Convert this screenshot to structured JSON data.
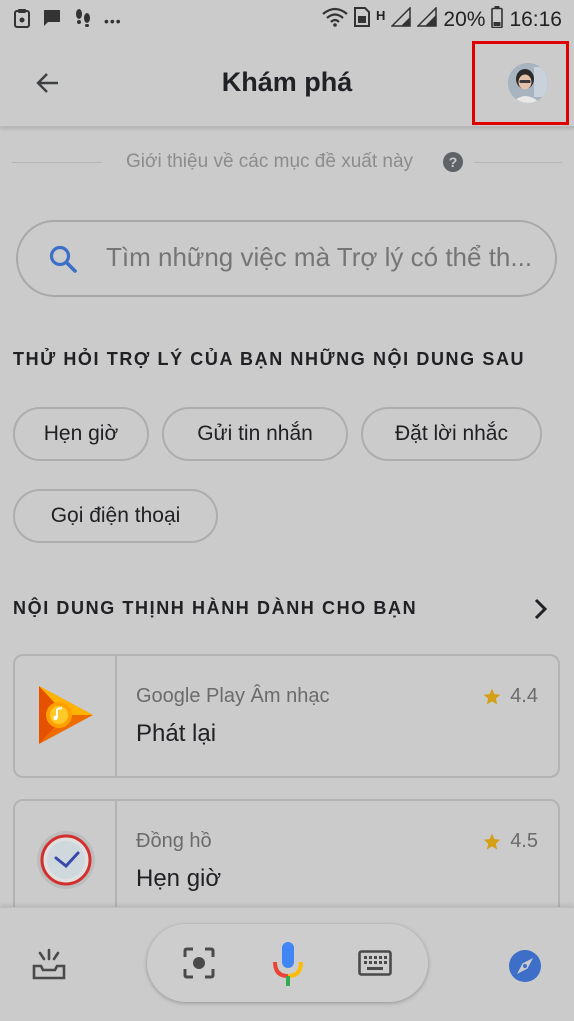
{
  "status_bar": {
    "battery_percent": "20%",
    "time": "16:16",
    "network_label": "H",
    "overflow_dots": "•••"
  },
  "app_bar": {
    "title": "Khám phá"
  },
  "intro": {
    "text": "Giới thiệu về các mục đề xuất này",
    "help_glyph": "?"
  },
  "search": {
    "placeholder": "Tìm những việc mà Trợ lý có thể th..."
  },
  "try_section": {
    "header": "THỬ HỎI TRỢ LÝ CỦA BẠN NHỮNG NỘI DUNG SAU",
    "chips": [
      "Hẹn giờ",
      "Gửi tin nhắn",
      "Đặt lời nhắc",
      "Gọi điện thoại"
    ]
  },
  "trending_section": {
    "header": "NỘI DUNG THỊNH HÀNH DÀNH CHO BẠN",
    "cards": [
      {
        "source": "Google Play Âm nhạc",
        "title": "Phát lại",
        "rating": "4.4",
        "icon": "google-play-music-icon"
      },
      {
        "source": "Đồng hồ",
        "title": "Hẹn giờ",
        "rating": "4.5",
        "icon": "clock-app-icon"
      }
    ]
  },
  "bottom_bar": {
    "icons": [
      "updates-icon",
      "lens-icon",
      "mic-icon",
      "keyboard-icon",
      "explore-compass-icon"
    ]
  },
  "colors": {
    "background": "#cbcbcb",
    "highlight_box": "#e00000",
    "search_icon": "#3c6fc7",
    "star": "#d4a017",
    "compass": "#3d6fc8"
  }
}
